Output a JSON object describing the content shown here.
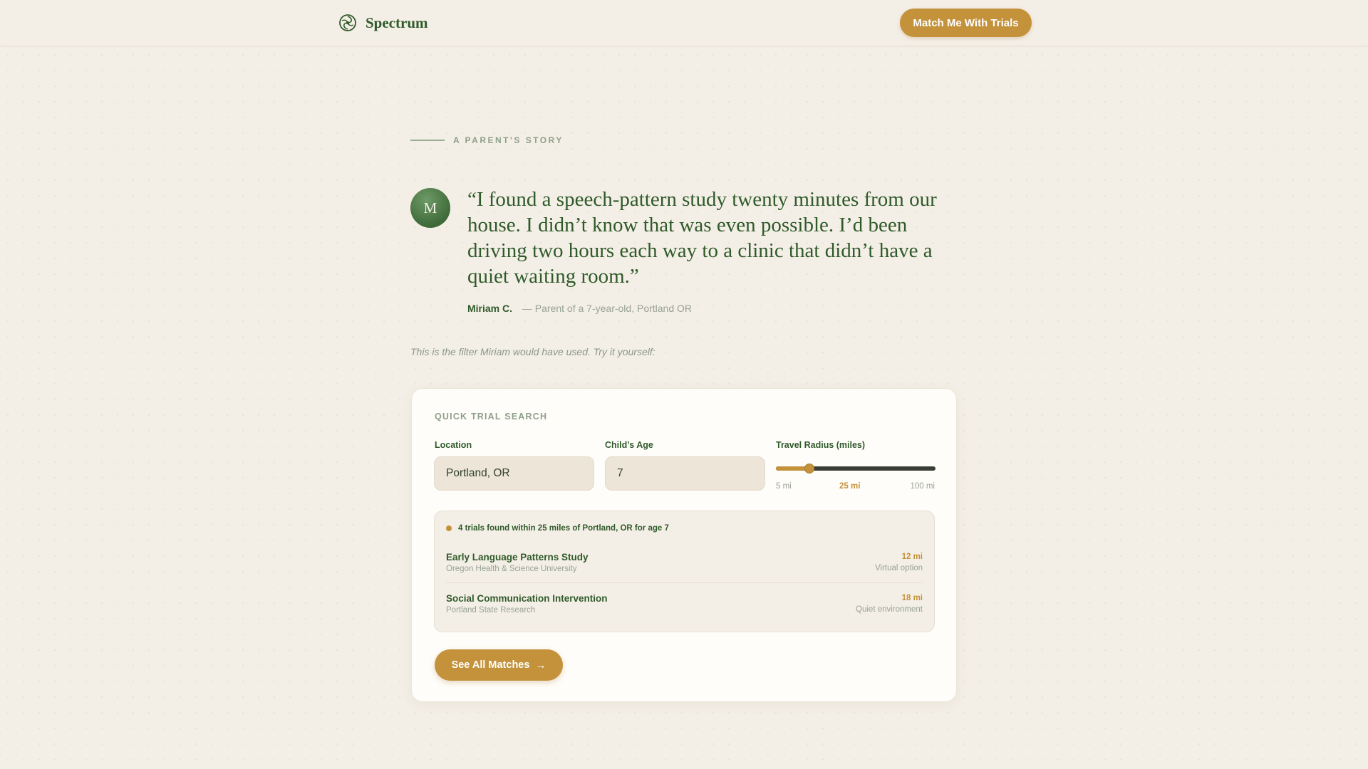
{
  "header": {
    "brand_name": "Spectrum",
    "brand_icon": "spectrum-swirl-icon",
    "cta_label": "Match Me With Trials"
  },
  "story": {
    "eyebrow": "A PARENT'S STORY",
    "avatar_initial": "M",
    "quote": "“I found a speech-pattern study twenty minutes from our house. I didn’t know that was even possible. I’d been driving two hours each way to a clinic that didn’t have a quiet waiting room.”",
    "author_name": "Miriam C.",
    "author_meta": "— Parent of a 7-year-old, Portland OR",
    "intro_note": "This is the filter Miriam would have used. Try it yourself:"
  },
  "search": {
    "title": "QUICK TRIAL SEARCH",
    "location_label": "Location",
    "location_value": "Portland, OR",
    "age_label": "Child’s Age",
    "age_value": "7",
    "radius_label": "Travel Radius (miles)",
    "radius_min_label": "5 mi",
    "radius_value_label": "25 mi",
    "radius_max_label": "100 mi",
    "radius_min": 5,
    "radius_max": 100,
    "radius_value": 25
  },
  "results": {
    "summary": "4 trials found within 25 miles of Portland, OR for age 7",
    "trials": [
      {
        "title": "Early Language Patterns Study",
        "org": "Oregon Health & Science University",
        "distance": "12 mi",
        "tag": "Virtual option"
      },
      {
        "title": "Social Communication Intervention",
        "org": "Portland State Research",
        "distance": "18 mi",
        "tag": "Quiet environment"
      }
    ],
    "see_all_label": "See All Matches",
    "see_all_icon": "arrow-right-icon"
  },
  "colors": {
    "background": "#f4efe6",
    "primary_green": "#2f5a2a",
    "accent_gold": "#c3923b",
    "muted_text": "#98a294"
  }
}
